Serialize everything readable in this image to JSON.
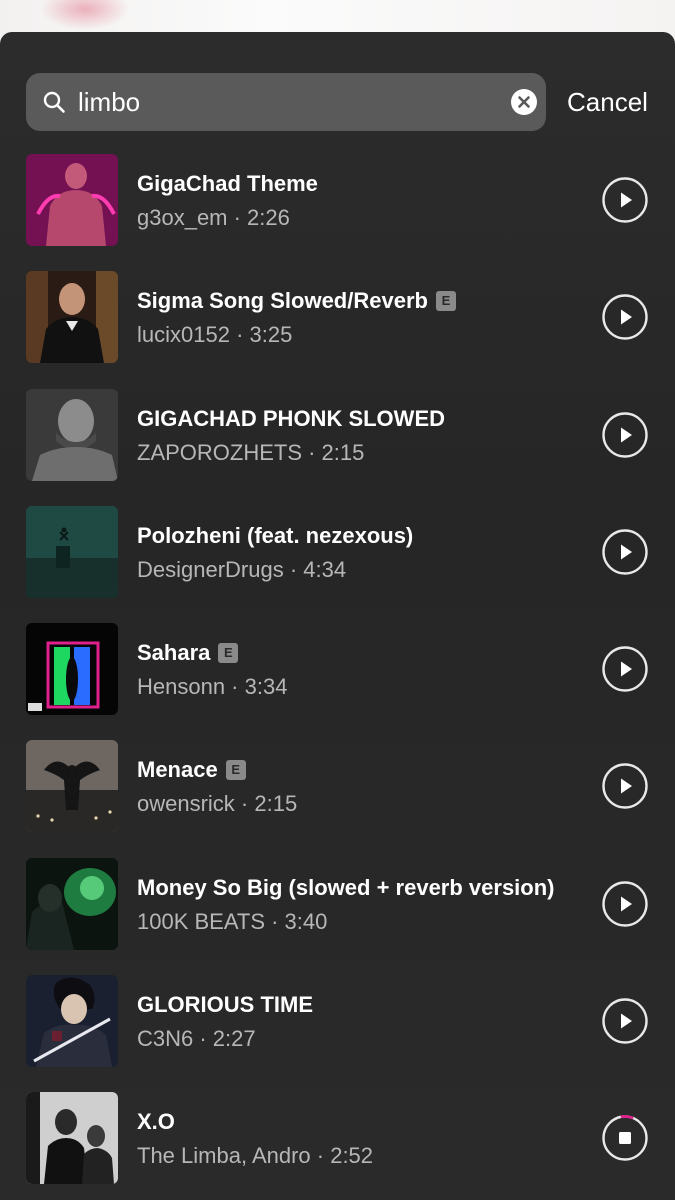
{
  "search": {
    "value": "limbo",
    "cancel_label": "Cancel"
  },
  "icons": {
    "search": "search-icon",
    "clear": "clear-icon",
    "play": "play-icon",
    "stop": "stop-icon",
    "explicit_label": "E"
  },
  "colors": {
    "sheet_background": "#2a2a2a",
    "search_box": "#5a5a5a",
    "primary_text": "#ffffff",
    "secondary_text": "#b7b7b7",
    "loading_accent": "#e0208c"
  },
  "tracks": [
    {
      "title": "GigaChad Theme",
      "subtitle": "g3ox_em · 2:26",
      "explicit": false,
      "state": "play"
    },
    {
      "title": "Sigma Song Slowed/Reverb",
      "subtitle": "lucix0152 · 3:25",
      "explicit": true,
      "state": "play"
    },
    {
      "title": "GIGACHAD PHONK SLOWED",
      "subtitle": "ZAPOROZHETS · 2:15",
      "explicit": false,
      "state": "play"
    },
    {
      "title": "Polozheni (feat. nezexous)",
      "subtitle": "DesignerDrugs · 4:34",
      "explicit": false,
      "state": "play"
    },
    {
      "title": "Sahara",
      "subtitle": "Hensonn · 3:34",
      "explicit": true,
      "state": "play"
    },
    {
      "title": "Menace",
      "subtitle": "owensrick · 2:15",
      "explicit": true,
      "state": "play"
    },
    {
      "title": "Money So Big (slowed + reverb version)",
      "subtitle": "100K BEATS · 3:40",
      "explicit": false,
      "state": "play"
    },
    {
      "title": "GLORIOUS TIME",
      "subtitle": "C3N6 · 2:27",
      "explicit": false,
      "state": "play"
    },
    {
      "title": "X.O",
      "subtitle": "The Limba, Andro · 2:52",
      "explicit": false,
      "state": "loading"
    }
  ]
}
